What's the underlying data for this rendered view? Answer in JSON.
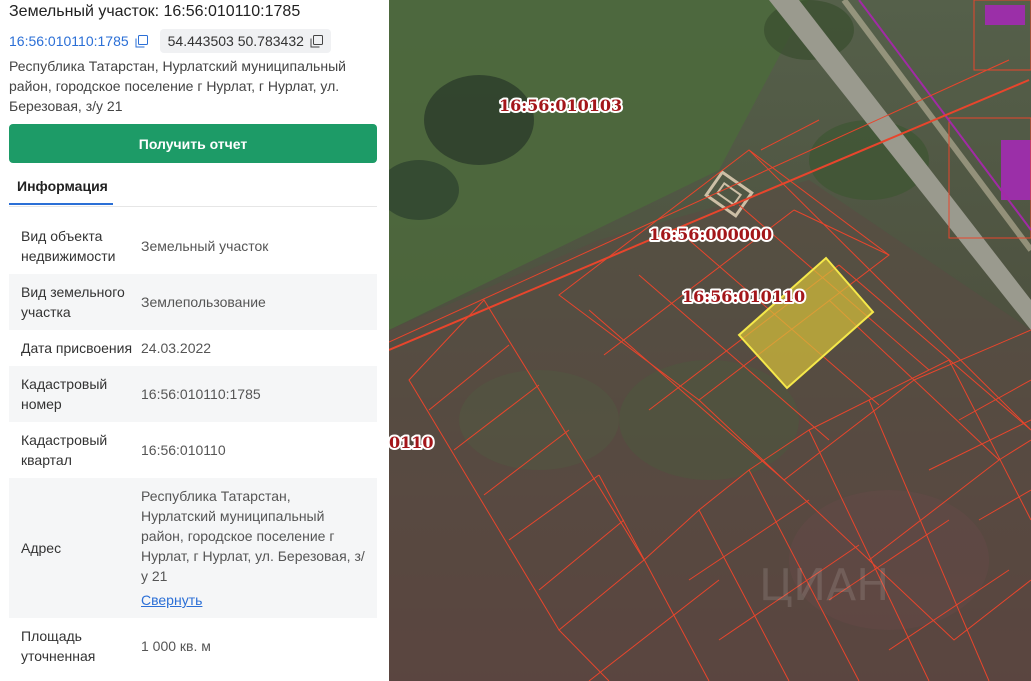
{
  "panel": {
    "title": "Земельный участок: 16:56:010110:1785",
    "cadastral_link": "16:56:010110:1785",
    "coordinates": "54.443503 50.783432",
    "address": "Республика Татарстан, Нурлатский муниципальный район, городское поселение г Нурлат, г Нурлат, ул. Березовая, з/у 21",
    "report_button": "Получить отчет",
    "tab_info": "Информация",
    "collapse_link": "Свернуть",
    "rows": [
      {
        "label": "Вид объекта недвижимости",
        "value": "Земельный участок"
      },
      {
        "label": "Вид земельного участка",
        "value": "Землепользование"
      },
      {
        "label": "Дата присвоения",
        "value": "24.03.2022"
      },
      {
        "label": "Кадастровый номер",
        "value": "16:56:010110:1785"
      },
      {
        "label": "Кадастровый квартал",
        "value": "16:56:010110"
      },
      {
        "label": "Адрес",
        "value": "Республика Татарстан, Нурлатский муниципальный район, городское поселение г Нурлат, г Нурлат, ул. Березовая, з/у 21"
      },
      {
        "label": "Площадь уточненная",
        "value": "1 000 кв. м"
      }
    ]
  },
  "map": {
    "labels": {
      "quarter_north": "16:56:010103",
      "zero": "16:56:000000",
      "quarter_main": "16:56:010110",
      "quarter_edge": "0110"
    },
    "colors": {
      "parcel_line": "#e8452c",
      "selected_fill": "#d9c23a",
      "selected_stroke": "#f5e84a",
      "road": "#9a9a8e",
      "boundary_purple": "#a22aa6",
      "roof": "#9b2fa8"
    }
  }
}
